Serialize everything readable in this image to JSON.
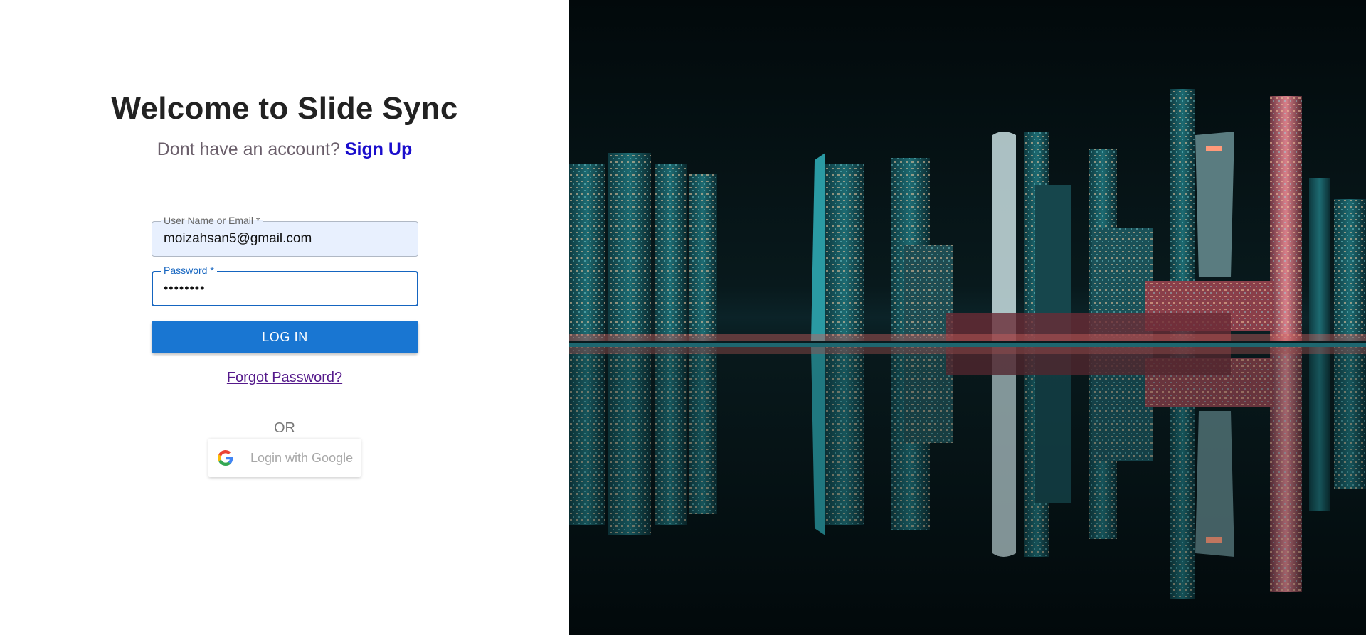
{
  "header": {
    "title": "Welcome to Slide Sync",
    "subtitle_prefix": "Dont have an account?",
    "signup_label": "Sign Up"
  },
  "form": {
    "email_label": "User Name or Email *",
    "email_value": "moizahsan5@gmail.com",
    "password_label": "Password *",
    "password_value": "••••••••",
    "login_label": "LOG IN",
    "forgot_label": "Forgot Password?",
    "or_label": "OR",
    "google_label": "Login with Google",
    "google_icon": "google-g-icon"
  },
  "hero": {
    "image": "night-city-skyline-reflection"
  },
  "colors": {
    "primary": "#1976d2",
    "signup_link": "#1a0dcc",
    "forgot_link": "#551a8b",
    "email_field_bg": "#e8f0fe"
  }
}
